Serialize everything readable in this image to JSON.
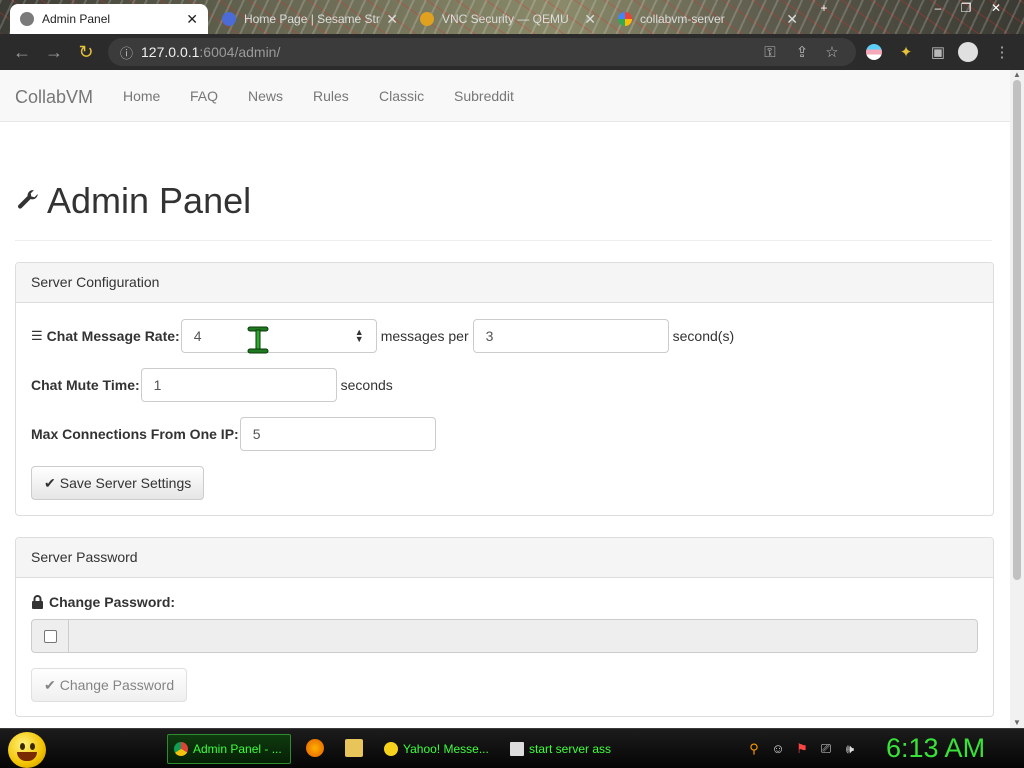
{
  "browser": {
    "tabs": [
      {
        "title": "Admin Panel",
        "active": true
      },
      {
        "title": "Home Page | Sesame Str",
        "active": false
      },
      {
        "title": "VNC Security — QEMU",
        "active": false
      },
      {
        "title": "collabvm-server",
        "active": false
      }
    ],
    "url_host": "127.0.0.1",
    "url_path": ":6004/admin/"
  },
  "site": {
    "brand": "CollabVM",
    "nav": [
      "Home",
      "FAQ",
      "News",
      "Rules",
      "Classic",
      "Subreddit"
    ]
  },
  "page": {
    "title": "Admin Panel"
  },
  "server_config": {
    "heading": "Server Configuration",
    "chat_rate_label": "Chat Message Rate:",
    "chat_rate_value": "4",
    "messages_per": "messages per",
    "chat_rate_seconds_value": "3",
    "seconds_suffix": "second(s)",
    "mute_label": "Chat Mute Time:",
    "mute_value": "1",
    "mute_suffix": "seconds",
    "max_conn_label": "Max Connections From One IP:",
    "max_conn_value": "5",
    "save_button": "Save Server Settings"
  },
  "server_password": {
    "heading": "Server Password",
    "change_label": "Change Password:",
    "checkbox_checked": false,
    "password_value": "",
    "change_button": "Change Password"
  },
  "taskbar": {
    "items": [
      {
        "label": "Admin Panel - ...",
        "active": true
      },
      {
        "label": "Yahoo! Messe...",
        "active": false
      },
      {
        "label": "start server ass",
        "active": false
      }
    ],
    "clock": "6:13 AM"
  },
  "colors": {
    "taskbar_text": "#3cff3c",
    "clock": "#39e239",
    "page_heading": "#333333",
    "nav_text": "#777777"
  }
}
